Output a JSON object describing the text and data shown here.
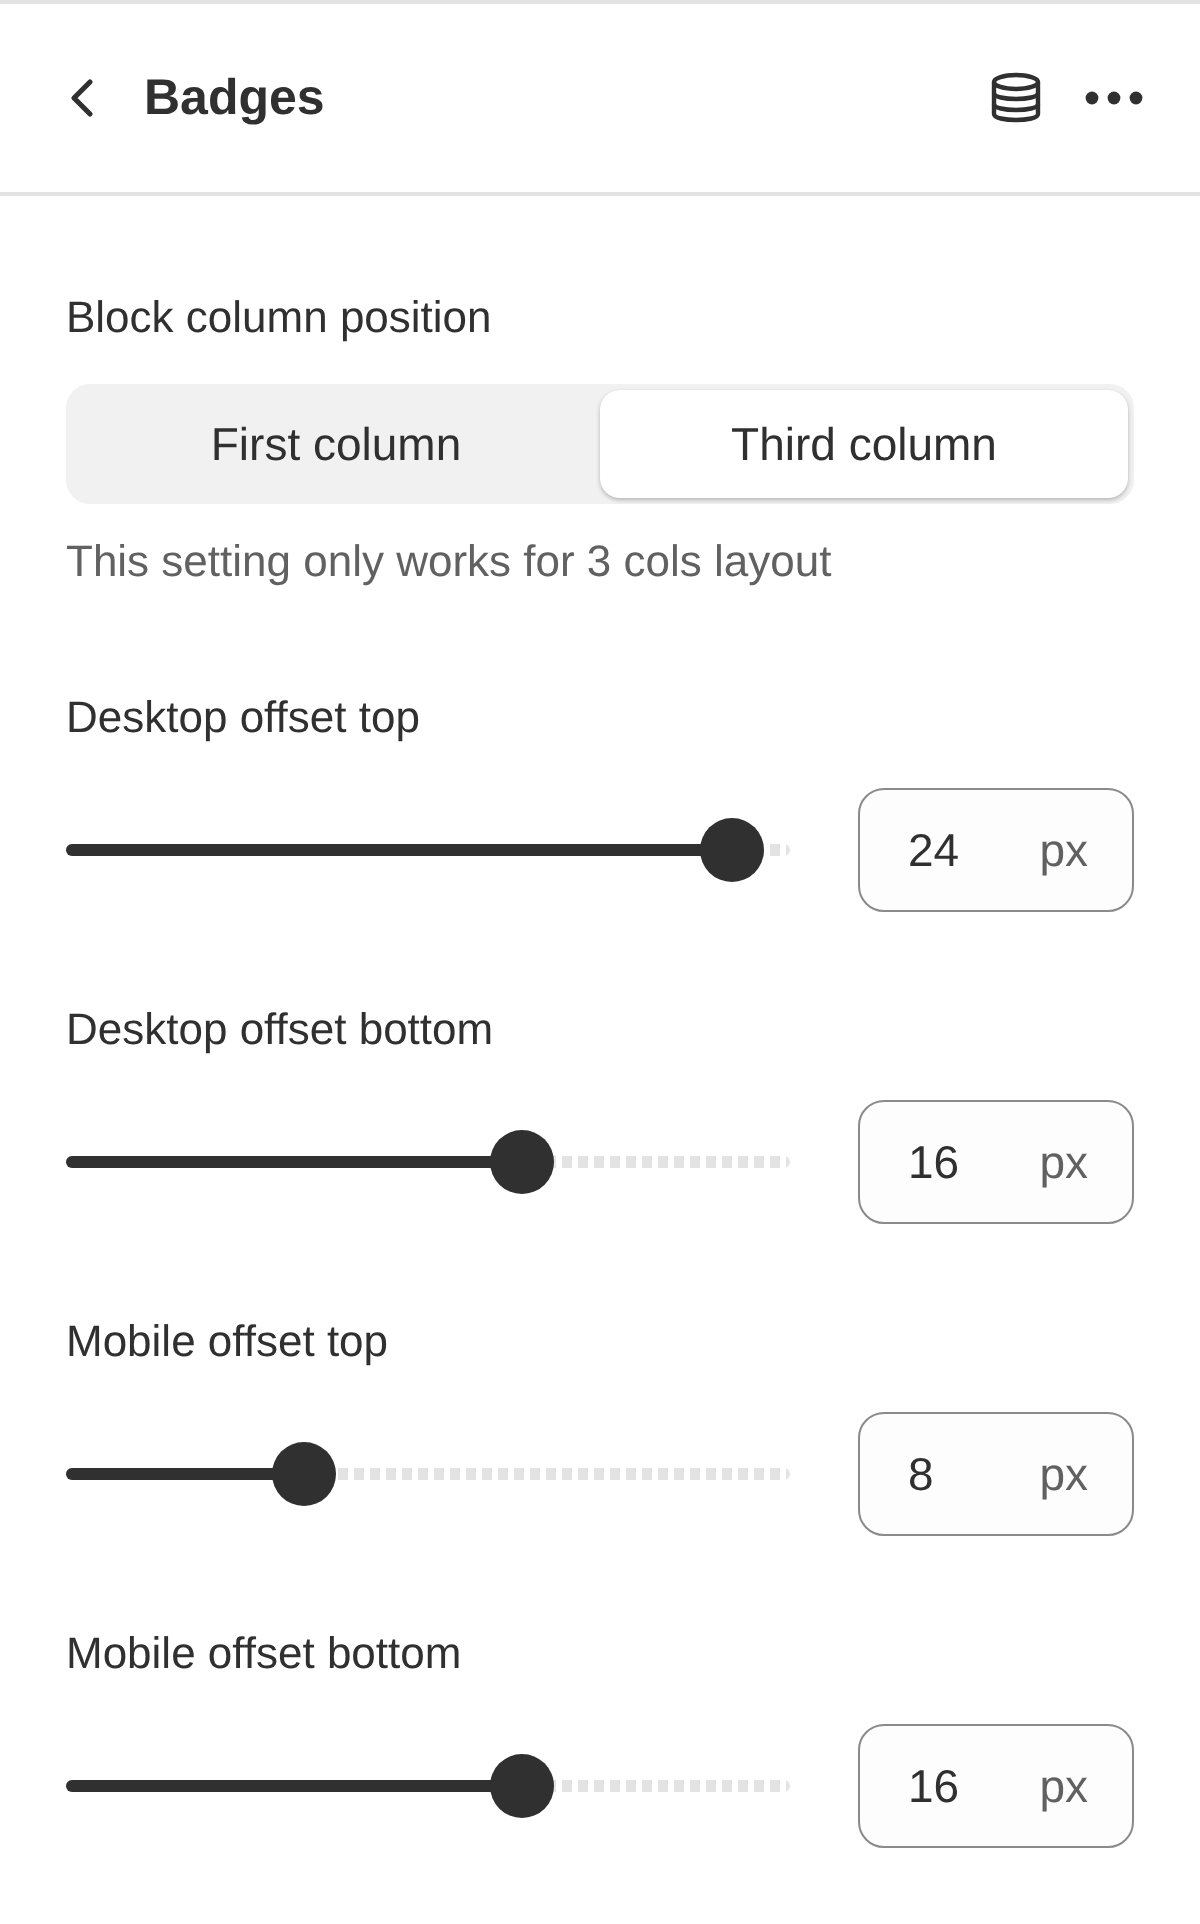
{
  "header": {
    "title": "Badges"
  },
  "segmented": {
    "label": "Block column position",
    "options": [
      {
        "label": "First column",
        "selected": false
      },
      {
        "label": "Third column",
        "selected": true
      }
    ],
    "help": "This setting only works for 3 cols layout"
  },
  "sliders": [
    {
      "label": "Desktop offset top",
      "level": 0.92,
      "value": "24",
      "unit": "px"
    },
    {
      "label": "Desktop offset bottom",
      "level": 0.63,
      "value": "16",
      "unit": "px"
    },
    {
      "label": "Mobile offset top",
      "level": 0.33,
      "value": "8",
      "unit": "px"
    },
    {
      "label": "Mobile offset bottom",
      "level": 0.63,
      "value": "16",
      "unit": "px"
    }
  ]
}
